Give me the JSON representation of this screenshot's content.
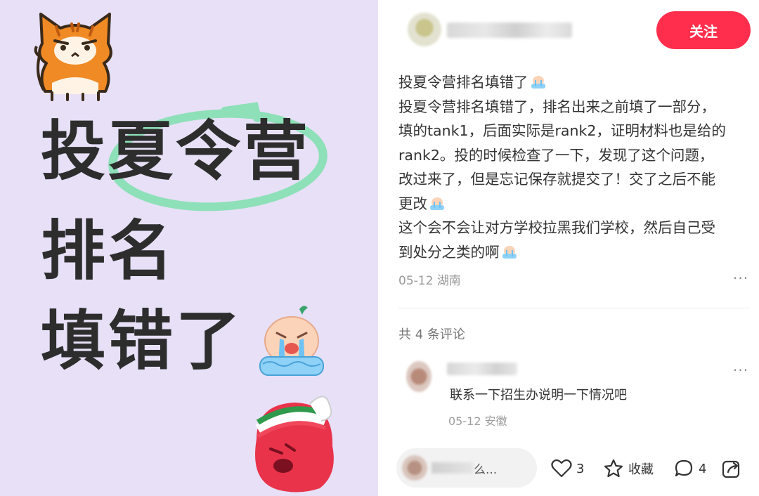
{
  "image": {
    "headline_lines": [
      "投夏令营",
      "排名",
      "填错了"
    ]
  },
  "post": {
    "follow_label": "关注",
    "lines": [
      "投夏令营排名填错了",
      "投夏令营排名填错了，排名出来之前填了一部分，",
      "填的tank1，后面实际是rank2，证明材料也是给的",
      "rank2。投的时候检查了一下，发现了这个问题，",
      "改过来了，但是忘记保存就提交了！交了之后不能",
      "更改",
      "这个会不会让对方学校拉黑我们学校，然后自己受",
      "到处分之类的啊"
    ],
    "date": "05-12",
    "location": "湖南",
    "more": "···"
  },
  "comments": {
    "count_label": "共 4 条评论",
    "items": [
      {
        "text": "联系一下招生办说明一下情况吧",
        "date": "05-12",
        "location": "安徽"
      }
    ]
  },
  "bottom_bar": {
    "input_placeholder": "么...",
    "likes": "3",
    "favorite_label": "收藏",
    "comment_count": "4"
  },
  "colors": {
    "accent": "#ff2e4d",
    "image_bg": "#e7e0f7",
    "highlight_circle": "#8ee0b8"
  },
  "icons": [
    "heart-icon",
    "star-icon",
    "comment-bubble-icon",
    "share-icon",
    "cat-sticker",
    "crying-emoji",
    "sick-emoji"
  ]
}
